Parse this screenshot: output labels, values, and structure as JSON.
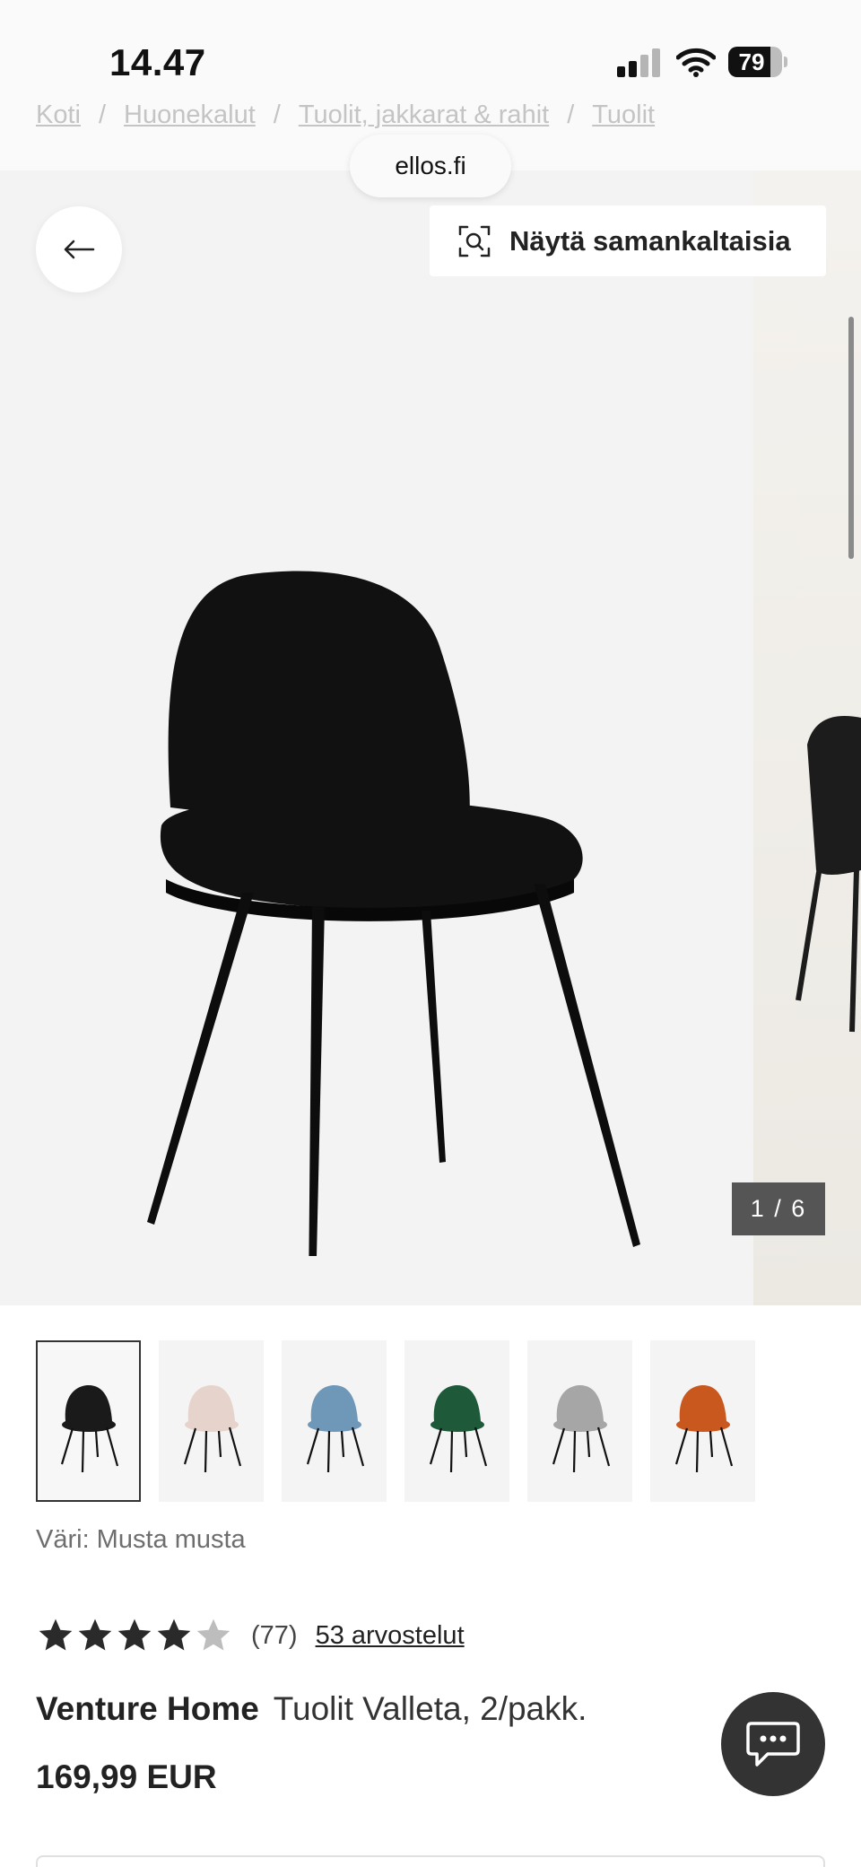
{
  "status_bar": {
    "time": "14.47",
    "battery": "79",
    "battery_level": 0.79
  },
  "browser": {
    "url": "ellos.fi"
  },
  "breadcrumb": [
    "Koti",
    "Huonekalut",
    "Tuolit, jakkarat & rahit",
    "Tuolit"
  ],
  "gallery": {
    "similar_label": "Näytä samankaltaisia",
    "counter": "1 / 6",
    "image_color": "#111111"
  },
  "thumbnails": [
    {
      "color": "#1a1a1a"
    },
    {
      "color": "#e6d4cc"
    },
    {
      "color": "#6f97b8"
    },
    {
      "color": "#1e5a3a"
    },
    {
      "color": "#a6a6a6"
    },
    {
      "color": "#c9581f"
    }
  ],
  "color_label": "Väri: Musta musta",
  "rating": {
    "stars": 4,
    "max": 5,
    "count": "(77)",
    "reviews_link": "53 arvostelut"
  },
  "product": {
    "brand": "Venture Home",
    "name": "Tuolit Valleta, 2/pakk.",
    "price": "169,99 EUR"
  },
  "icons": [
    "back-arrow-icon",
    "visual-search-icon",
    "chat-icon",
    "star-icon",
    "wifi-icon",
    "signal-icon",
    "battery-icon"
  ]
}
